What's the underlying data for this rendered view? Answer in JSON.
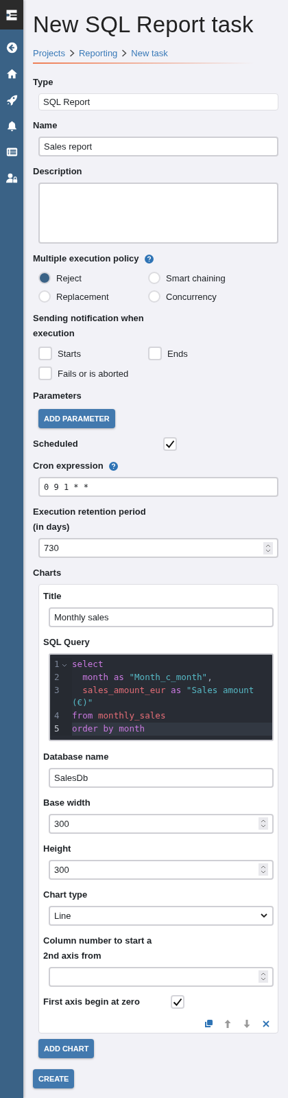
{
  "title": "New SQL Report task",
  "breadcrumb": [
    "Projects",
    "Reporting",
    "New task"
  ],
  "form": [
    {
      "kind": "readonly",
      "label": "Type",
      "value": "SQL Report"
    },
    {
      "kind": "text",
      "label": "Name",
      "value": "Sales report"
    },
    {
      "kind": "textarea",
      "label": "Description"
    },
    {
      "kind": "radios",
      "label": "Multiple execution policy",
      "help": true,
      "options": [
        {
          "label": "Reject",
          "selected": true
        },
        {
          "label": "Smart chaining",
          "selected": false
        },
        {
          "label": "Replacement",
          "selected": false
        },
        {
          "label": "Concurrency",
          "selected": false
        }
      ]
    },
    {
      "kind": "checks",
      "label": "Sending notification when execution",
      "options": [
        {
          "label": "Starts",
          "checked": false
        },
        {
          "label": "Ends",
          "checked": false
        },
        {
          "label": "Fails or is aborted",
          "checked": false
        }
      ]
    },
    {
      "kind": "button",
      "label": "Parameters",
      "button": "ADD PARAMETER"
    },
    {
      "kind": "toggle",
      "label": "Scheduled",
      "checked": true
    },
    {
      "kind": "mono",
      "label": "Cron expression",
      "help": true,
      "value": "0 9 1 * *"
    },
    {
      "kind": "number",
      "label": "Execution retention period (in days)",
      "value": "730"
    },
    {
      "kind": "charts",
      "label": "Charts",
      "button": "ADD CHART",
      "items": [
        {
          "fields": [
            {
              "kind": "text",
              "label": "Title",
              "value": "Monthly sales"
            },
            {
              "kind": "code",
              "label": "SQL Query",
              "lines": [
                {
                  "number": "1",
                  "fold": true,
                  "active": false,
                  "tokens": [
                    {
                      "kind": "keyword",
                      "text": "select"
                    }
                  ]
                },
                {
                  "number": "2",
                  "fold": false,
                  "active": false,
                  "tokens": [
                    {
                      "kind": "keyword",
                      "text": "  month as "
                    },
                    {
                      "kind": "string",
                      "text": "\"Month_c_month\""
                    },
                    {
                      "kind": "punct",
                      "text": ","
                    }
                  ]
                },
                {
                  "number": "3",
                  "fold": false,
                  "active": false,
                  "tokens": [
                    {
                      "kind": "identifier",
                      "text": "  sales_amount_eur"
                    },
                    {
                      "kind": "keyword",
                      "text": " as "
                    },
                    {
                      "kind": "string",
                      "text": "\"Sales amount (€)\""
                    }
                  ]
                },
                {
                  "number": "4",
                  "fold": false,
                  "active": false,
                  "tokens": [
                    {
                      "kind": "keyword",
                      "text": "from "
                    },
                    {
                      "kind": "identifier",
                      "text": "monthly_sales"
                    }
                  ]
                },
                {
                  "number": "5",
                  "fold": false,
                  "active": true,
                  "tokens": [
                    {
                      "kind": "keyword",
                      "text": "order by month"
                    }
                  ]
                }
              ]
            },
            {
              "kind": "text",
              "label": "Database name",
              "value": "SalesDb"
            },
            {
              "kind": "number",
              "label": "Base width",
              "value": "300"
            },
            {
              "kind": "number",
              "label": "Height",
              "value": "300"
            },
            {
              "kind": "select",
              "label": "Chart type",
              "value": "Line"
            },
            {
              "kind": "number",
              "label": "Column number to start a 2nd axis from"
            },
            {
              "kind": "toggle",
              "label": "First axis begin at zero",
              "checked": true
            }
          ],
          "actions": [
            {
              "kind": "duplicate",
              "disabled": false
            },
            {
              "kind": "up",
              "disabled": true
            },
            {
              "kind": "down",
              "disabled": true
            },
            {
              "kind": "remove",
              "disabled": false
            }
          ]
        }
      ]
    }
  ],
  "submit": "CREATE"
}
